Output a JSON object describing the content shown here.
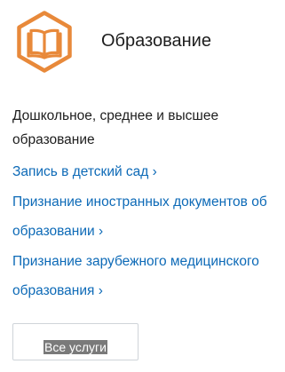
{
  "category": {
    "icon": "book-icon",
    "icon_color": "#e8893a",
    "title": "Образование",
    "description_line1": "Дошкольное, среднее и высшее",
    "description_line2": "образование"
  },
  "links": [
    {
      "line1": "Запись в детский сад ›"
    },
    {
      "line1": "Признание иностранных документов об",
      "line2": "образовании ›"
    },
    {
      "line1": "Признание зарубежного медицинского",
      "line2": "образования ›"
    }
  ],
  "link_color": "#0d6ab7",
  "all_services_button": {
    "label": "Все услуги"
  }
}
